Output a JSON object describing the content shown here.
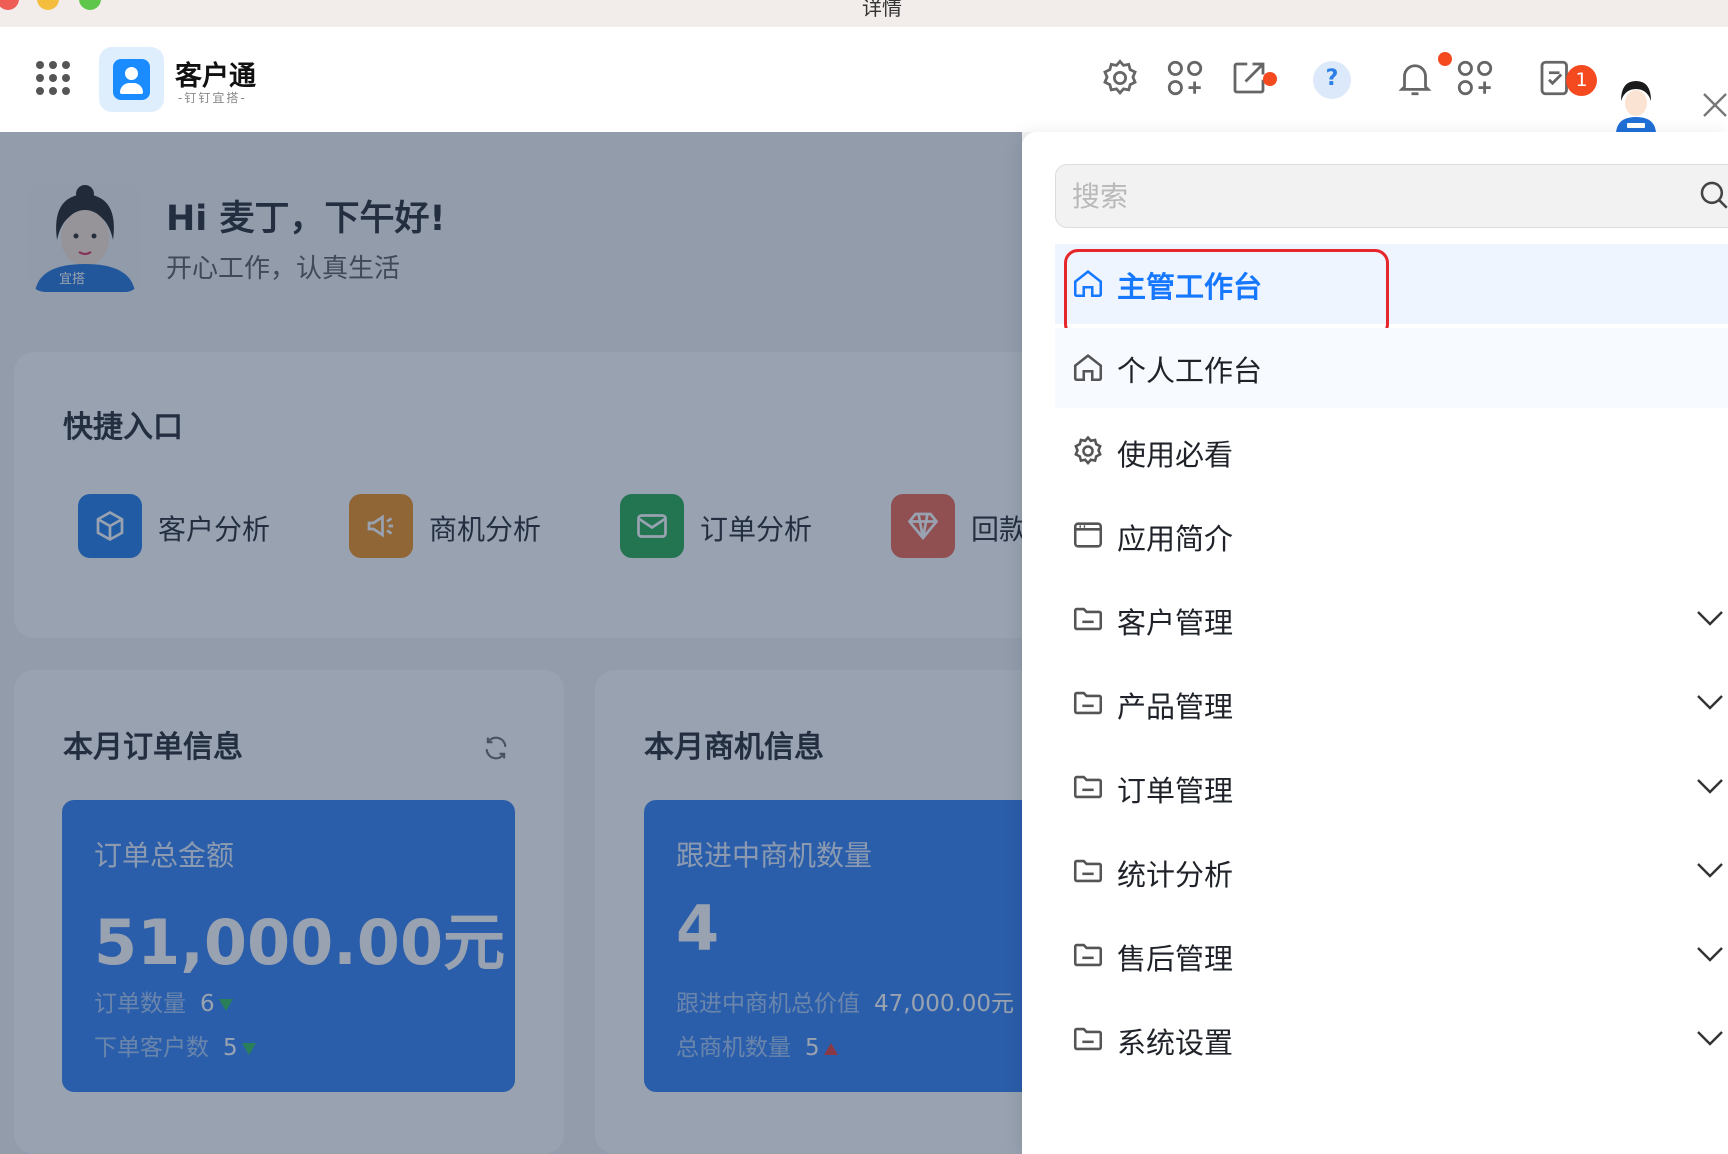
{
  "window": {
    "title": "详情"
  },
  "header": {
    "app_name": "客户通",
    "app_sub": "-钉钉宜搭-",
    "todo_badge": "1",
    "icons": [
      "grid-menu-icon",
      "gear-icon",
      "apps-icon",
      "share-icon",
      "help-icon",
      "bell-icon",
      "apps-icon",
      "todo-icon",
      "avatar",
      "close-icon"
    ]
  },
  "greeting": {
    "title": "Hi 麦丁，下午好!",
    "subtitle": "开心工作，认真生活",
    "avatar_tag": "宜搭"
  },
  "quick": {
    "title": "快捷入口",
    "items": [
      {
        "label": "客户分析",
        "color": "#1a77e8",
        "icon": "cube-icon"
      },
      {
        "label": "商机分析",
        "color": "#f08c17",
        "icon": "megaphone-icon"
      },
      {
        "label": "订单分析",
        "color": "#1fa84a",
        "icon": "mail-icon"
      },
      {
        "label": "回款",
        "color": "#f0604a",
        "icon": "diamond-icon"
      }
    ]
  },
  "orders": {
    "title": "本月订单信息",
    "box_label": "订单总金额",
    "value": "51,000.00元",
    "meta1_label": "订单数量",
    "meta1_value": "6",
    "meta2_label": "下单客户数",
    "meta2_value": "5"
  },
  "opps": {
    "title": "本月商机信息",
    "box_label": "跟进中商机数量",
    "value": "4",
    "meta1_label": "跟进中商机总价值",
    "meta1_value": "47,000.00元",
    "meta2_label": "总商机数量",
    "meta2_value": "5"
  },
  "panel": {
    "search_placeholder": "搜索",
    "menu": [
      {
        "label": "主管工作台",
        "icon": "home-icon",
        "active": true
      },
      {
        "label": "个人工作台",
        "icon": "home-icon"
      },
      {
        "label": "使用必看",
        "icon": "gear-icon"
      },
      {
        "label": "应用简介",
        "icon": "window-icon"
      },
      {
        "label": "客户管理",
        "icon": "folder-icon",
        "expandable": true
      },
      {
        "label": "产品管理",
        "icon": "folder-icon",
        "expandable": true
      },
      {
        "label": "订单管理",
        "icon": "folder-icon",
        "expandable": true
      },
      {
        "label": "统计分析",
        "icon": "folder-icon",
        "expandable": true
      },
      {
        "label": "售后管理",
        "icon": "folder-icon",
        "expandable": true
      },
      {
        "label": "系统设置",
        "icon": "folder-icon",
        "expandable": true
      }
    ]
  },
  "colors": {
    "accent": "#1677ff",
    "stat_box": "#2f7ef3",
    "highlight": "#e5262b",
    "notification": "#f54a20"
  }
}
